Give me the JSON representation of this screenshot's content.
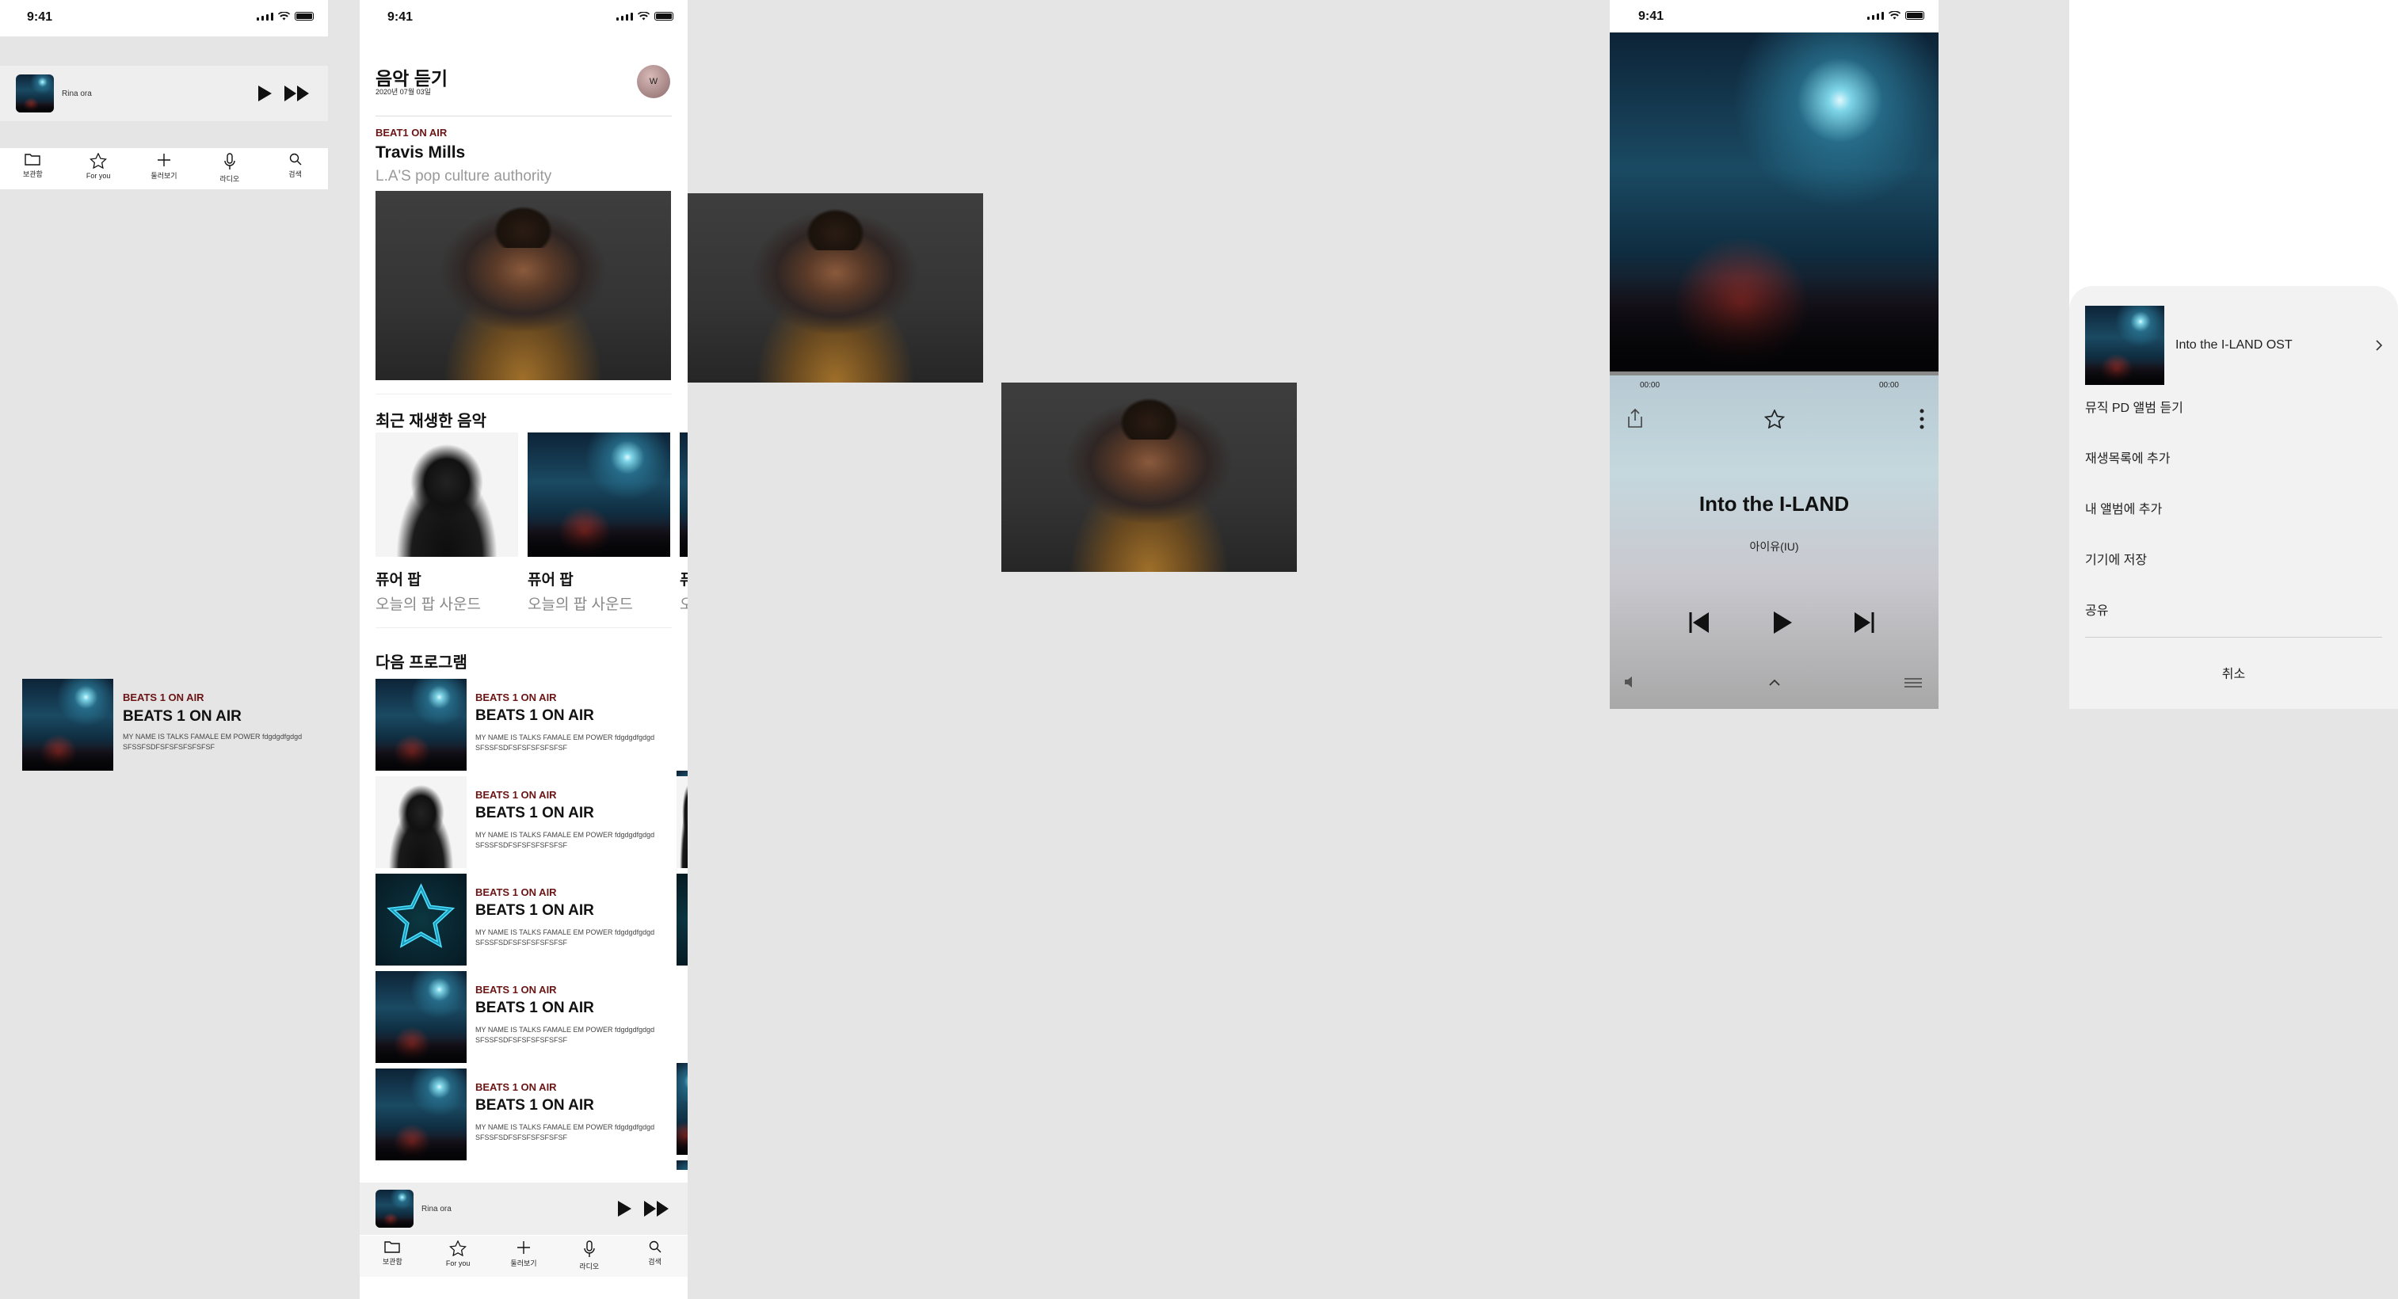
{
  "status_bar": {
    "time": "9:41"
  },
  "tab_bar": {
    "items": [
      {
        "label": "보관함",
        "icon": "folder-icon"
      },
      {
        "label": "For you",
        "icon": "star-icon"
      },
      {
        "label": "둘러보기",
        "icon": "plus-icon"
      },
      {
        "label": "라디오",
        "icon": "microphone-icon"
      },
      {
        "label": "검색",
        "icon": "search-icon"
      }
    ]
  },
  "mini_player": {
    "title": "Rina ora"
  },
  "browse": {
    "page_title": "음악 듣기",
    "date": "2020년 07월 03일",
    "avatar_initial": "W",
    "feature": {
      "kicker": "BEAT1 ON AIR",
      "title": "Travis Mills",
      "subtitle": "L.A'S pop culture authority"
    },
    "recent_heading": "최근 재생한 음악",
    "recent": [
      {
        "title": "퓨어 팝",
        "subtitle": "오늘의 팝 사운드"
      },
      {
        "title": "퓨어 팝",
        "subtitle": "오늘의 팝 사운드"
      },
      {
        "title": "퓨",
        "subtitle": "오"
      }
    ],
    "next_heading": "다음 프로그램",
    "programs": [
      {
        "kicker": "BEATS 1 ON AIR",
        "title": "BEATS 1 ON AIR",
        "desc": "MY NAME IS TALKS FAMALE EM POWER fdgdgdfgdgd SFSSFSDFSFSFSFSFSFSF"
      },
      {
        "kicker": "BEATS 1 ON AIR",
        "title": "BEATS 1 ON AIR",
        "desc": "MY NAME IS TALKS FAMALE EM POWER fdgdgdfgdgd SFSSFSDFSFSFSFSFSFSF"
      },
      {
        "kicker": "BEATS 1 ON AIR",
        "title": "BEATS 1 ON AIR",
        "desc": "MY NAME IS TALKS FAMALE EM POWER fdgdgdfgdgd SFSSFSDFSFSFSFSFSFSF"
      },
      {
        "kicker": "BEATS 1 ON AIR",
        "title": "BEATS 1 ON AIR",
        "desc": "MY NAME IS TALKS FAMALE EM POWER fdgdgdfgdgd SFSSFSDFSFSFSFSFSFSF"
      },
      {
        "kicker": "BEATS 1 ON AIR",
        "title": "BEATS 1 ON AIR",
        "desc": "MY NAME IS TALKS FAMALE EM POWER fdgdgdfgdgd SFSSFSDFSFSFSFSFSFSF"
      }
    ]
  },
  "standalone_program": {
    "kicker": "BEATS 1 ON AIR",
    "title": "BEATS 1 ON AIR",
    "desc": "MY NAME IS TALKS FAMALE EM POWER fdgdgdfgdgd SFSSFSDFSFSFSFSFSFSF"
  },
  "now_playing": {
    "elapsed": "00:00",
    "remaining": "00:00",
    "progress": 0,
    "song_title": "Into the I-LAND",
    "artist": "아이유(IU)"
  },
  "action_sheet": {
    "album_title": "Into the I-LAND OST",
    "items": [
      "뮤직 PD 앨범 듣기",
      "재생목록에 추가",
      "내 앨범에 추가",
      "기기에 저장",
      "공유"
    ],
    "cancel": "취소"
  },
  "colors": {
    "kicker": "#6b1414",
    "background": "#e5e5e5",
    "sheet": "#f2f2f2"
  }
}
